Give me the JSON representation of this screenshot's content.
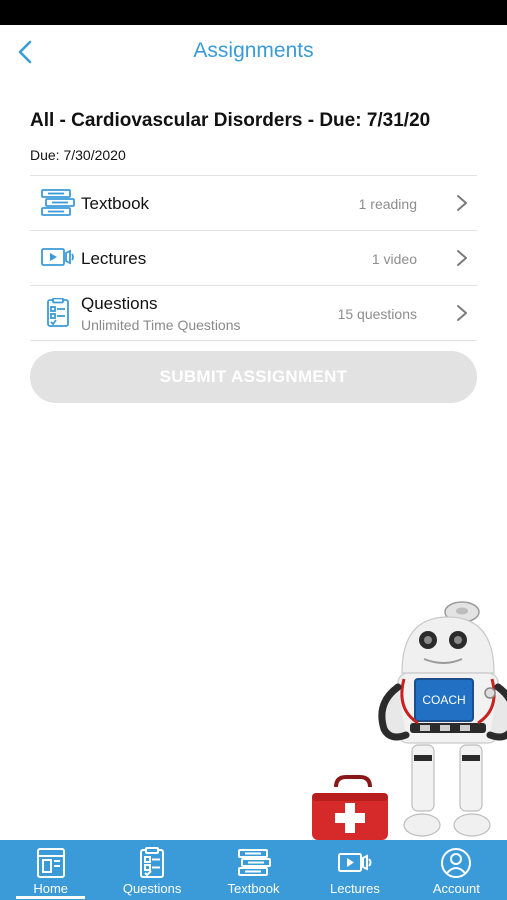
{
  "header": {
    "title": "Assignments"
  },
  "assignment": {
    "title": "All - Cardiovascular Disorders - Due: 7/31/20",
    "due": "Due: 7/30/2020"
  },
  "rows": [
    {
      "label": "Textbook",
      "count": "1 reading",
      "icon": "textbook-icon"
    },
    {
      "label": "Lectures",
      "count": "1 video",
      "icon": "lectures-icon"
    },
    {
      "label": "Questions",
      "sublabel": "Unlimited Time Questions",
      "count": "15 questions",
      "icon": "questions-icon"
    }
  ],
  "submit": {
    "label": "SUBMIT ASSIGNMENT",
    "enabled": false
  },
  "mascot": {
    "badge": "COACH"
  },
  "tabs": [
    {
      "label": "Home",
      "icon": "home-icon",
      "active": true
    },
    {
      "label": "Questions",
      "icon": "questions-icon",
      "active": false
    },
    {
      "label": "Textbook",
      "icon": "textbook-icon",
      "active": false
    },
    {
      "label": "Lectures",
      "icon": "lectures-icon",
      "active": false
    },
    {
      "label": "Account",
      "icon": "account-icon",
      "active": false
    }
  ],
  "colors": {
    "accent": "#3b9bd8",
    "disabled": "#e2e2e2",
    "tabbar": "#3b9bd8"
  }
}
